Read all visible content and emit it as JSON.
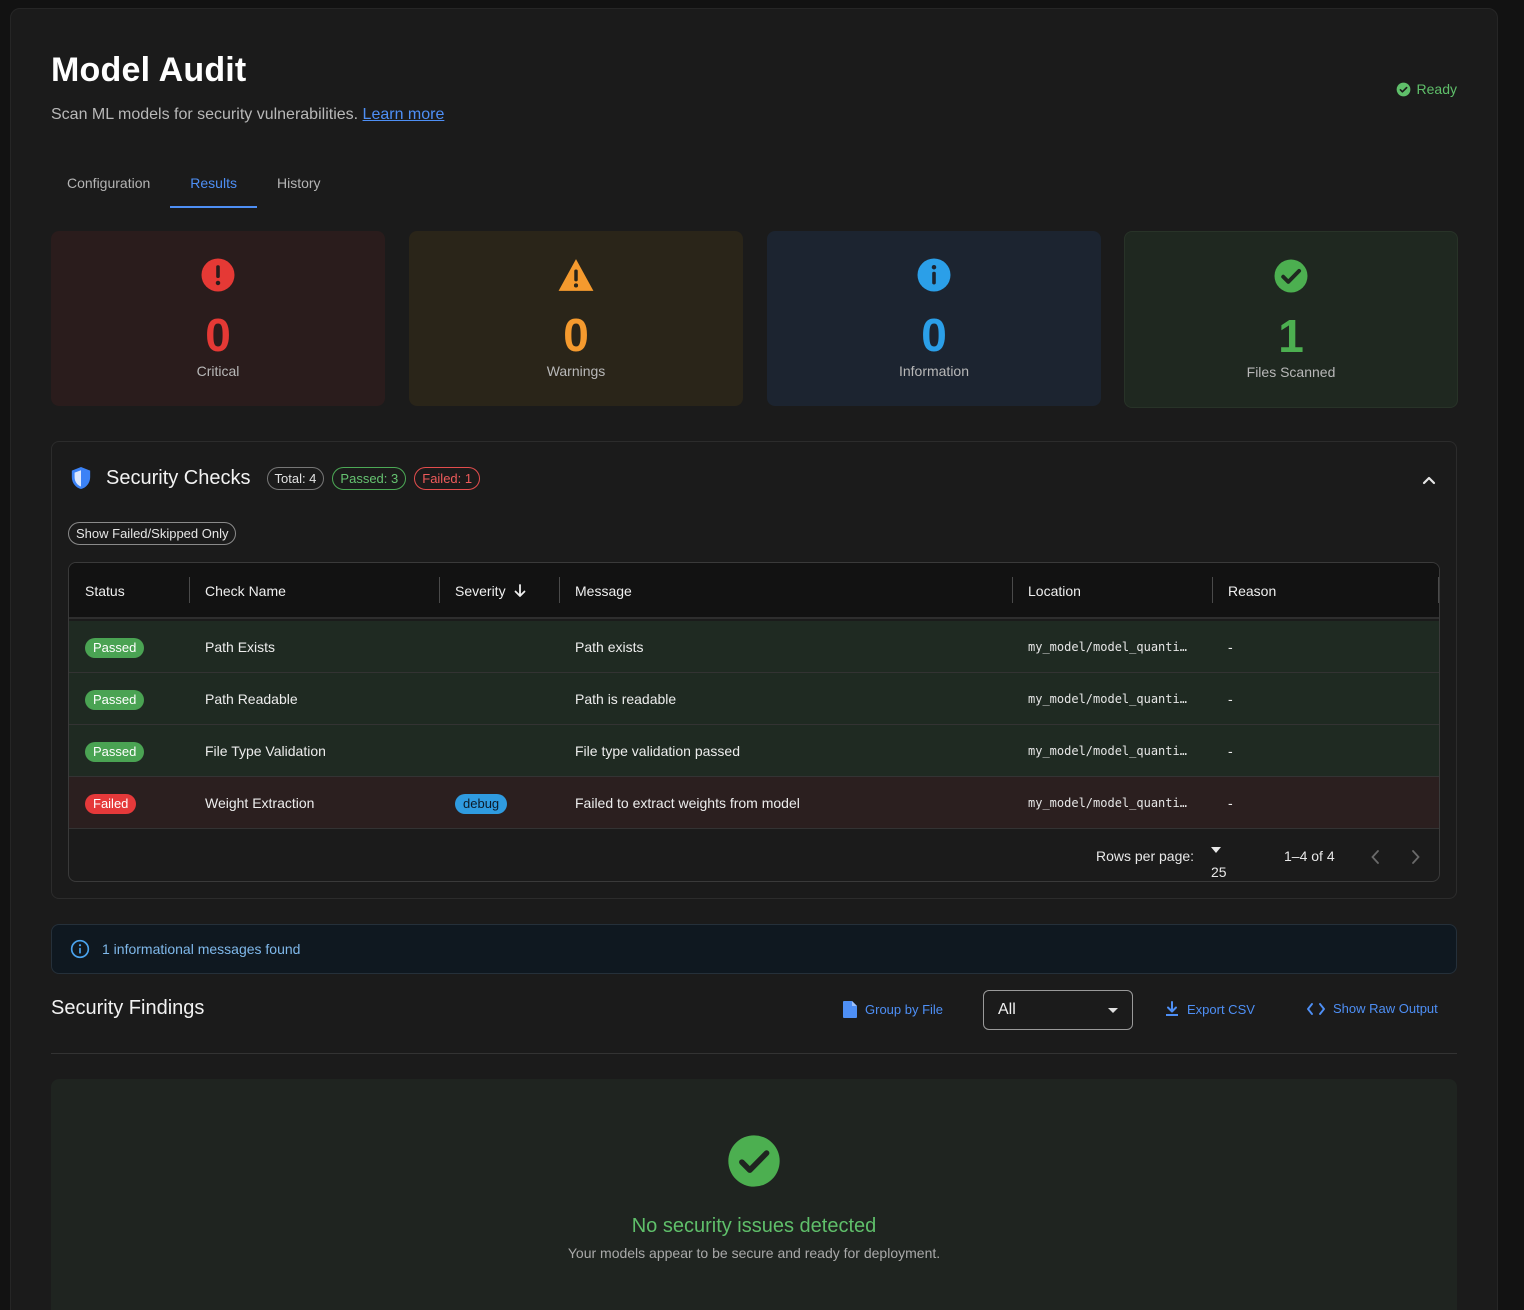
{
  "header": {
    "title": "Model Audit",
    "subtitle": "Scan ML models for security vulnerabilities.",
    "learn_more": "Learn more",
    "status": "Ready"
  },
  "tabs": [
    {
      "label": "Configuration",
      "active": false
    },
    {
      "label": "Results",
      "active": true
    },
    {
      "label": "History",
      "active": false
    }
  ],
  "summary": {
    "critical": {
      "value": "0",
      "label": "Critical",
      "color": "#e53935"
    },
    "warnings": {
      "value": "0",
      "label": "Warnings",
      "color": "#f59a2e"
    },
    "information": {
      "value": "0",
      "label": "Information",
      "color": "#2b9fe8"
    },
    "files": {
      "value": "1",
      "label": "Files Scanned",
      "color": "#4caf50"
    }
  },
  "security_checks": {
    "title": "Security Checks",
    "total": "Total: 4",
    "passed": "Passed: 3",
    "failed": "Failed: 1",
    "filter_label": "Show Failed/Skipped Only",
    "columns": [
      "Status",
      "Check Name",
      "Severity",
      "Message",
      "Location",
      "Reason"
    ],
    "rows": [
      {
        "status": "Passed",
        "name": "Path Exists",
        "severity": "",
        "message": "Path exists",
        "location": "my_model/model_quanti…",
        "reason": "-"
      },
      {
        "status": "Passed",
        "name": "Path Readable",
        "severity": "",
        "message": "Path is readable",
        "location": "my_model/model_quanti…",
        "reason": "-"
      },
      {
        "status": "Passed",
        "name": "File Type Validation",
        "severity": "",
        "message": "File type validation passed",
        "location": "my_model/model_quanti…",
        "reason": "-"
      },
      {
        "status": "Failed",
        "name": "Weight Extraction",
        "severity": "debug",
        "message": "Failed to extract weights from model",
        "location": "my_model/model_quanti…",
        "reason": "-"
      }
    ],
    "pagination": {
      "rows_per_page_label": "Rows per page:",
      "rows_per_page": "25",
      "range": "1–4 of 4"
    }
  },
  "info_banner": "1 informational messages found",
  "findings": {
    "title": "Security Findings",
    "group_by_file": "Group by File",
    "filter_value": "All",
    "export_csv": "Export CSV",
    "show_raw": "Show Raw Output",
    "empty_title": "No security issues detected",
    "empty_subtitle": "Your models appear to be secure and ready for deployment."
  }
}
